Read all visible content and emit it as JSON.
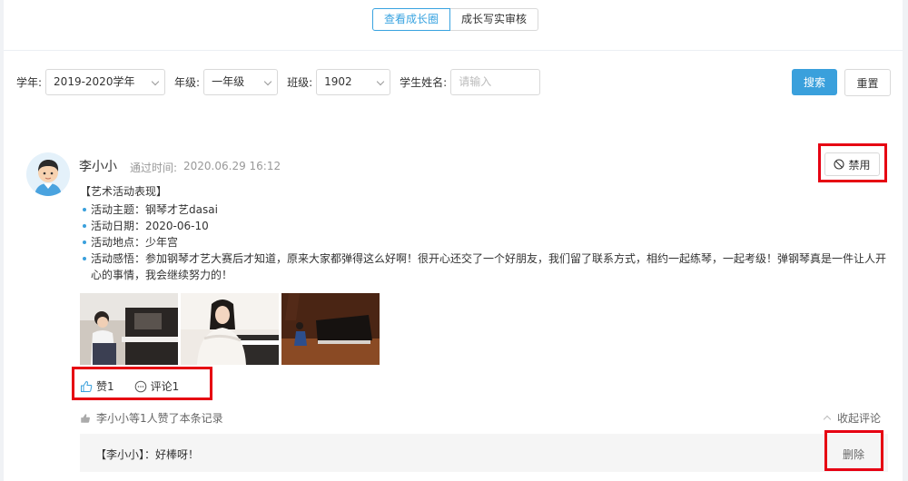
{
  "tabs": [
    {
      "label": "查看成长圈",
      "active": true
    },
    {
      "label": "成长写实审核",
      "active": false
    }
  ],
  "filters": {
    "year_label": "学年:",
    "year_value": "2019-2020学年",
    "grade_label": "年级:",
    "grade_value": "一年级",
    "class_label": "班级:",
    "class_value": "1902",
    "student_label": "学生姓名:",
    "student_placeholder": "请输入",
    "student_value": "",
    "search_label": "搜索",
    "reset_label": "重置"
  },
  "post": {
    "author": "李小小",
    "time_label": "通过时间:",
    "time": "2020.06.29 16:12",
    "ban_label": "禁用",
    "section_title": "【艺术活动表现】",
    "details": [
      "活动主题：钢琴才艺dasai",
      "活动日期：2020-06-10",
      "活动地点：少年宫",
      "活动感悟：参加钢琴才艺大赛后才知道，原来大家都弹得这么好啊！很开心还交了一个好朋友，我们留了联系方式，相约一起练琴，一起考级！弹钢琴真是一件让人开心的事情，我会继续努力的！"
    ],
    "like_label": "赞1",
    "comment_label": "评论1",
    "likes_summary": "李小小等1人赞了本条记录",
    "collapse_label": "收起评论",
    "comments": [
      {
        "author": "【李小小】：",
        "text": "好棒呀！",
        "delete_label": "删除"
      }
    ]
  },
  "colors": {
    "accent": "#3aa0dc",
    "highlight": "#e60012"
  }
}
